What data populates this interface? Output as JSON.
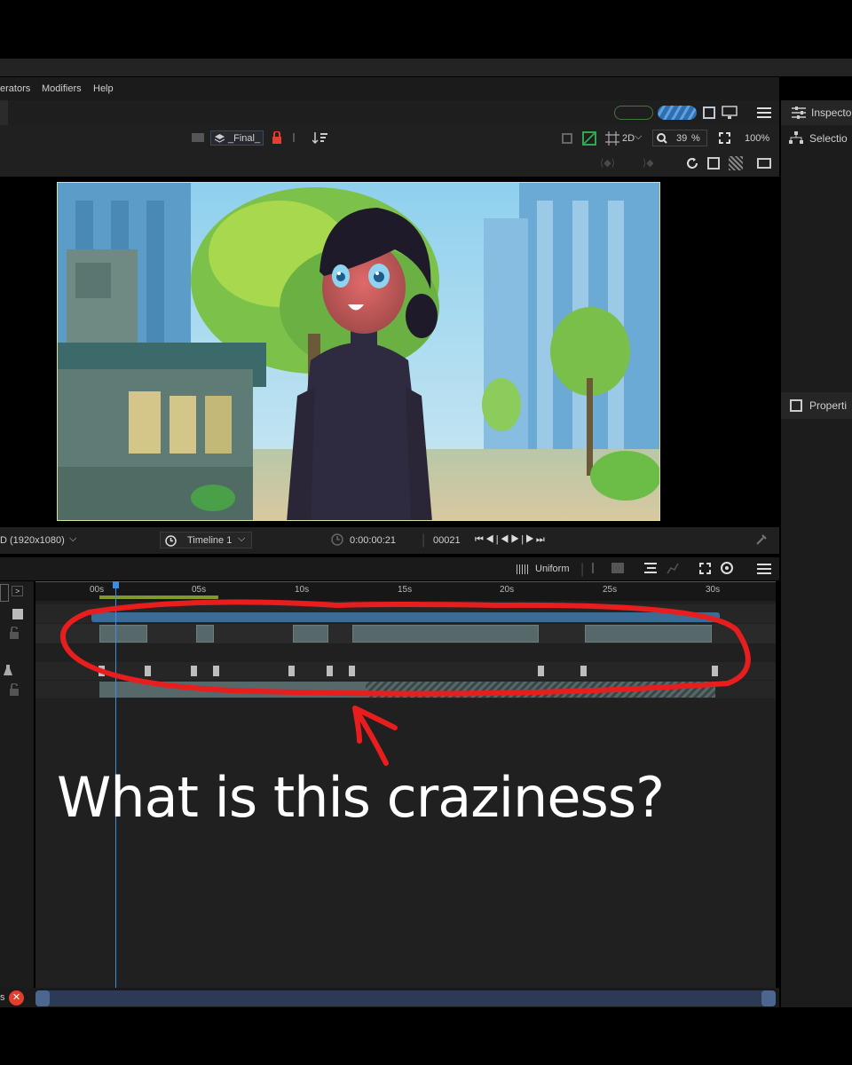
{
  "menu": {
    "items": [
      "erators",
      "Modifiers",
      "Help"
    ]
  },
  "toolbar": {
    "layer_label": "_Final_",
    "view_mode": "2D",
    "zoom_value": "39",
    "zoom_unit": "%",
    "fit_pct": "100%"
  },
  "right_panel": {
    "inspector_label": "Inspecto",
    "selection_label": "Selectio",
    "properties_label": "Properti"
  },
  "viewer_status": {
    "resolution": "D (1920x1080)",
    "timeline_label": "Timeline 1",
    "timecode": "0:00:00:21",
    "frame": "00021"
  },
  "timeline_toolbar": {
    "interp_label": "Uniform"
  },
  "ruler": {
    "ticks": [
      "00s",
      "05s",
      "10s",
      "15s",
      "20s",
      "25s",
      "30s"
    ]
  },
  "bottom": {
    "left_text": "s"
  },
  "annotation": {
    "caption": "What is this craziness?"
  },
  "colors": {
    "accent": "#2a7fd4",
    "annotation_red": "#e81e1e",
    "panel": "#202020"
  },
  "icons": [
    "clock-icon",
    "search-icon",
    "lock-icon",
    "play-icon",
    "skip-start-icon",
    "skip-end-icon",
    "menu-icon",
    "close-icon",
    "eyedropper-icon"
  ]
}
